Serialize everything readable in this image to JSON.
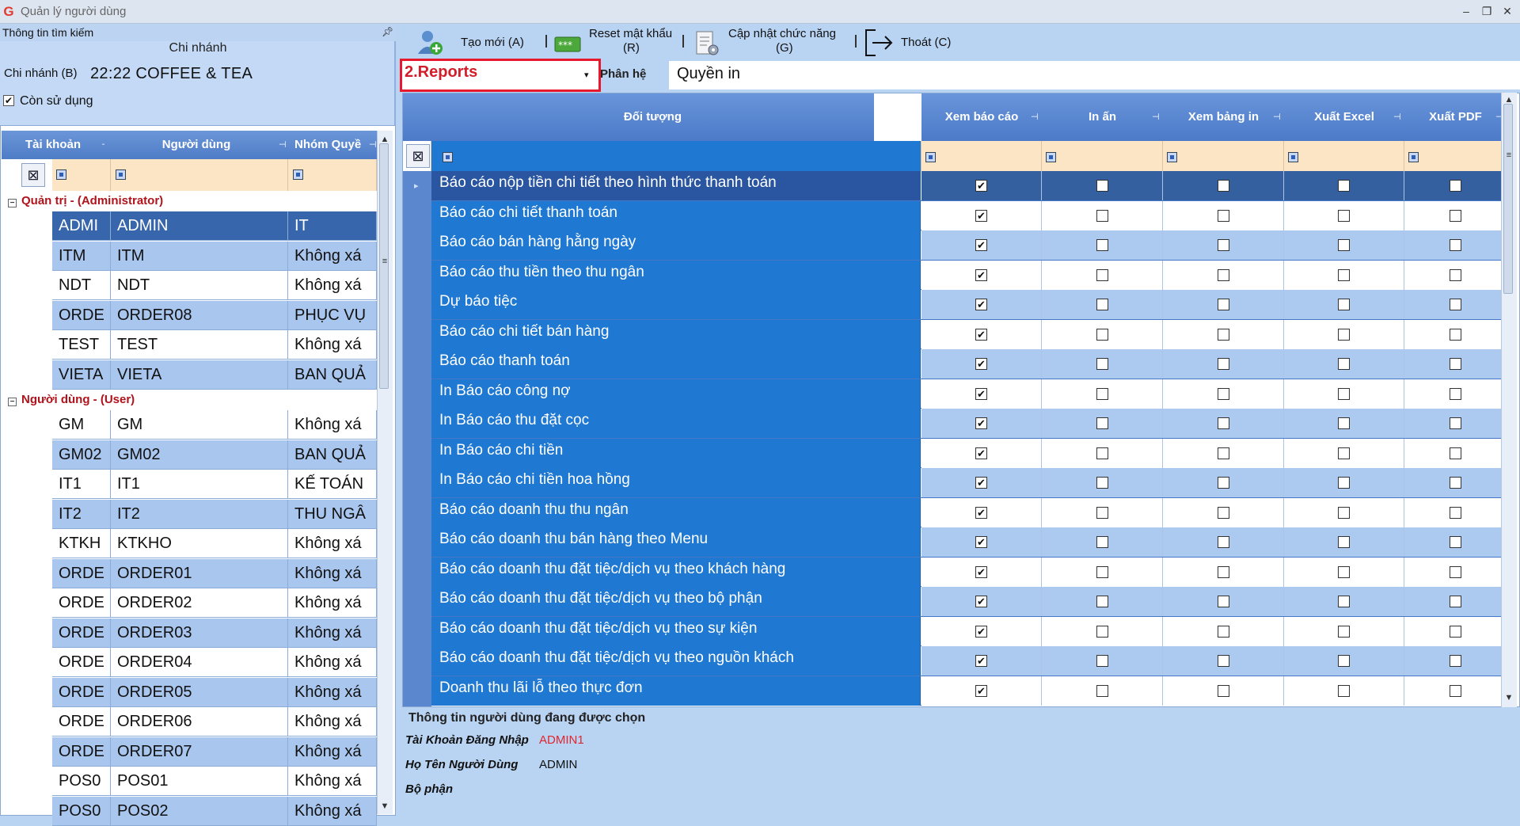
{
  "window": {
    "title": "Quản lý người dùng",
    "icon": "g-logo-icon"
  },
  "left": {
    "search_header": "Thông tin tìm kiếm",
    "branch_caption": "Chi nhánh",
    "branch_label": "Chi nhánh (B)",
    "branch_value": "22:22 COFFEE & TEA",
    "active_label": "Còn sử dụng",
    "active_checked": true,
    "columns": [
      "Tài khoản",
      "Người dùng",
      "Nhóm Quyề"
    ],
    "groups": [
      {
        "label": "Quản trị - (Administrator)",
        "rows": [
          [
            "ADMI",
            "ADMIN",
            "IT"
          ],
          [
            "ITM",
            "ITM",
            "Không xá"
          ],
          [
            "NDT",
            "NDT",
            "Không xá"
          ],
          [
            "ORDE",
            "ORDER08",
            "PHỤC VỤ"
          ],
          [
            "TEST",
            "TEST",
            "Không xá"
          ],
          [
            "VIETA",
            "VIETA",
            "BAN QUẢ"
          ]
        ]
      },
      {
        "label": "Người dùng - (User)",
        "rows": [
          [
            "GM",
            "GM",
            "Không xá"
          ],
          [
            "GM02",
            "GM02",
            "BAN QUẢ"
          ],
          [
            "IT1",
            "IT1",
            "KẾ TOÁN"
          ],
          [
            "IT2",
            "IT2",
            "THU NGÂ"
          ],
          [
            "KTKH",
            "KTKHO",
            "Không xá"
          ],
          [
            "ORDE",
            "ORDER01",
            "Không xá"
          ],
          [
            "ORDE",
            "ORDER02",
            "Không xá"
          ],
          [
            "ORDE",
            "ORDER03",
            "Không xá"
          ],
          [
            "ORDE",
            "ORDER04",
            "Không xá"
          ],
          [
            "ORDE",
            "ORDER05",
            "Không xá"
          ],
          [
            "ORDE",
            "ORDER06",
            "Không xá"
          ],
          [
            "ORDE",
            "ORDER07",
            "Không xá"
          ],
          [
            "POS0",
            "POS01",
            "Không xá"
          ],
          [
            "POS0",
            "POS02",
            "Không xá"
          ]
        ]
      }
    ]
  },
  "toolbar": {
    "new_label": "Tạo mới (A)",
    "reset_label_1": "Reset mật khẩu",
    "reset_label_2": "(R)",
    "update_label_1": "Cập nhật chức năng",
    "update_label_2": "(G)",
    "exit_label": "Thoát (C)"
  },
  "module": {
    "value": "2.Reports",
    "phanhe_label": "Phân hệ",
    "permission_type": "Quyền in"
  },
  "perm_grid": {
    "columns": [
      "Đối tượng",
      "Xem báo cáo",
      "In ấn",
      "Xem bảng in",
      "Xuất Excel",
      "Xuất PDF"
    ],
    "rows": [
      "Báo cáo nộp tiền chi tiết theo hình thức thanh toán",
      "Báo cáo chi tiết thanh toán",
      "Báo cáo bán hàng hằng ngày",
      "Báo cáo thu tiền theo thu ngân",
      "Dự báo tiệc",
      "Báo cáo chi tiết bán hàng",
      "Báo cáo thanh toán",
      "In Báo cáo công nợ",
      "In Báo cáo thu đặt cọc",
      "In Báo cáo chi tiền",
      "In Báo cáo chi tiền hoa hồng",
      "Báo cáo doanh thu thu ngân",
      "Báo cáo doanh thu bán hàng theo Menu",
      "Báo cáo doanh thu đặt tiệc/dịch vụ theo khách hàng",
      "Báo cáo doanh thu đặt tiệc/dịch vụ theo bộ phận",
      "Báo cáo doanh thu đặt tiệc/dịch vụ theo sự kiện",
      "Báo cáo doanh thu đặt tiệc/dịch vụ theo nguồn khách",
      "Doanh thu lãi lỗ theo thực đơn"
    ],
    "checked_column": "Xem báo cáo"
  },
  "details": {
    "header": "Thông tin người dùng đang được chọn",
    "login_label": "Tài Khoản Đăng Nhập",
    "login_value": "ADMIN1",
    "name_label": "Họ Tên Người Dùng",
    "name_value": "ADMIN",
    "dept_label": "Bộ phận",
    "dept_value": ""
  },
  "colors": {
    "accent_red": "#e8192c",
    "row_blue": "#1f78d2",
    "header_blue": "#5582cb"
  }
}
